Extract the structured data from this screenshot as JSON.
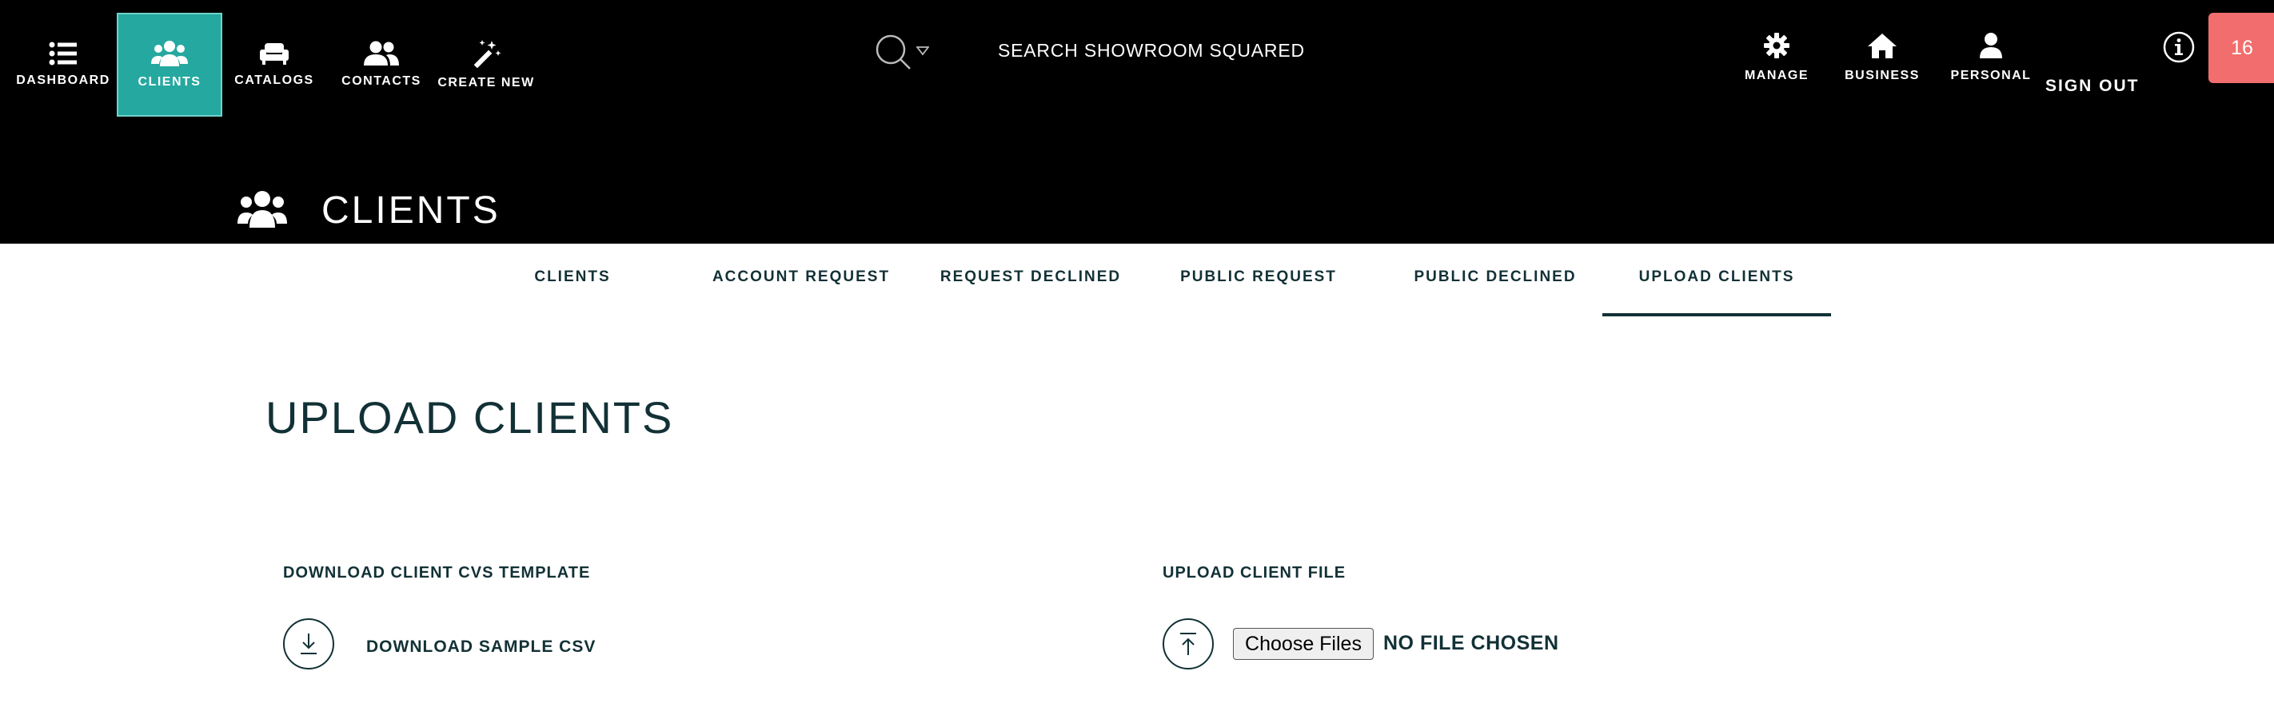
{
  "nav": {
    "items": [
      {
        "id": "dashboard",
        "label": "DASHBOARD",
        "icon": "list-icon"
      },
      {
        "id": "clients",
        "label": "CLIENTS",
        "icon": "users-group-icon",
        "active": true
      },
      {
        "id": "catalogs",
        "label": "CATALOGS",
        "icon": "sofa-icon"
      },
      {
        "id": "contacts",
        "label": "CONTACTS",
        "icon": "contacts-icon"
      },
      {
        "id": "create-new",
        "label": "CREATE NEW",
        "icon": "magic-wand-icon"
      }
    ],
    "active_color": "#25a8a0"
  },
  "search": {
    "placeholder": "SEARCH SHOWROOM SQUARED",
    "icon": "search-icon"
  },
  "right_nav": {
    "items": [
      {
        "id": "manage",
        "label": "MANAGE",
        "icon": "gear-icon"
      },
      {
        "id": "business",
        "label": "BUSINESS",
        "icon": "home-icon"
      },
      {
        "id": "personal",
        "label": "PERSONAL",
        "icon": "user-icon"
      }
    ],
    "sign_out": "SIGN OUT"
  },
  "badge": {
    "count": "16",
    "color": "#f26d6d"
  },
  "page": {
    "heading": "CLIENTS"
  },
  "tabs": [
    {
      "label": "CLIENTS"
    },
    {
      "label": "ACCOUNT REQUEST"
    },
    {
      "label": "REQUEST DECLINED"
    },
    {
      "label": "PUBLIC REQUEST"
    },
    {
      "label": "PUBLIC DECLINED"
    },
    {
      "label": "UPLOAD CLIENTS",
      "active": true
    }
  ],
  "main": {
    "title": "UPLOAD CLIENTS",
    "download": {
      "heading": "DOWNLOAD CLIENT CVS TEMPLATE",
      "link": "DOWNLOAD SAMPLE CSV"
    },
    "upload": {
      "heading": "UPLOAD CLIENT FILE",
      "button": "Choose Files",
      "status": "NO FILE CHOSEN"
    }
  },
  "colors": {
    "header_bg": "#000000",
    "text_dark": "#123136"
  }
}
